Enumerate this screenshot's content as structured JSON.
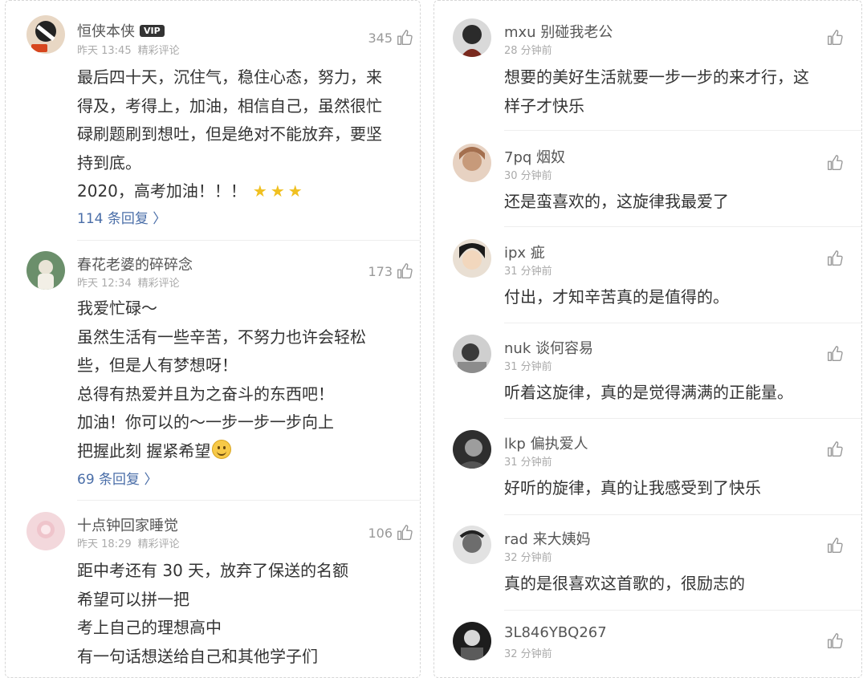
{
  "left": {
    "comments": [
      {
        "user": "恒侠本侠",
        "badge": "VIP",
        "time": "昨天 13:45",
        "tag": "精彩评论",
        "likes": "345",
        "lines": [
          "最后四十天，沉住气，稳住心态，努力，来",
          "得及，考得上，加油，相信自己，虽然很忙",
          "碌刷题刷到想吐，但是绝对不能放弃，要坚",
          "持到底。",
          "2020，高考加油！！！"
        ],
        "stars": "★★★",
        "replies": "114 条回复 〉"
      },
      {
        "user": "春花老婆的碎碎念",
        "time": "昨天 12:34",
        "tag": "精彩评论",
        "likes": "173",
        "lines": [
          "我爱忙碌～",
          "虽然生活有一些辛苦，不努力也许会轻松",
          "些，但是人有梦想呀！",
          "总得有热爱并且为之奋斗的东西吧！",
          "加油！你可以的～一步一步一步向上",
          "把握此刻  握紧希望"
        ],
        "replies": "69 条回复 〉"
      },
      {
        "user": "十点钟回家睡觉",
        "time": "昨天 18:29",
        "tag": "精彩评论",
        "likes": "106",
        "lines": [
          "距中考还有 30 天，放弃了保送的名额",
          "希望可以拼一把",
          "考上自己的理想高中",
          "有一句话想送给自己和其他学子们"
        ]
      }
    ]
  },
  "right": {
    "comments": [
      {
        "user": "mxu 别碰我老公",
        "time": "28 分钟前",
        "lines": [
          "想要的美好生活就要一步一步的来才行，这",
          "样子才快乐"
        ]
      },
      {
        "user": "7pq 烟奴",
        "time": "30 分钟前",
        "lines": [
          "还是蛮喜欢的，这旋律我最爱了"
        ]
      },
      {
        "user": "ipx 疵",
        "time": "31 分钟前",
        "lines": [
          "付出，才知辛苦真的是值得的。"
        ]
      },
      {
        "user": "nuk 谈何容易",
        "time": "31 分钟前",
        "lines": [
          "听着这旋律，真的是觉得满满的正能量。"
        ]
      },
      {
        "user": "lkp 偏执爱人",
        "time": "31 分钟前",
        "lines": [
          "好听的旋律，真的让我感受到了快乐"
        ]
      },
      {
        "user": "rad 来大姨妈",
        "time": "32 分钟前",
        "lines": [
          "真的是很喜欢这首歌的，很励志的"
        ]
      },
      {
        "user": "3L846YBQ267",
        "time": "32 分钟前",
        "lines": []
      }
    ]
  },
  "colors": {
    "accent": "#4a6ea8",
    "meta": "#aaaaaa",
    "text": "#333333"
  }
}
